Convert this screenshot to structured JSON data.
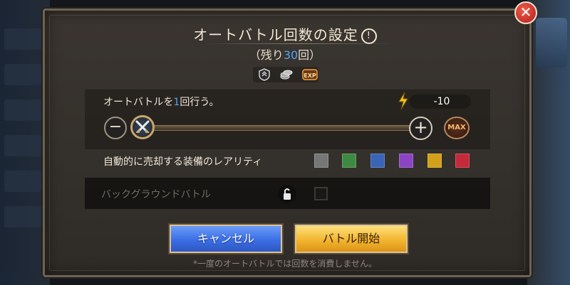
{
  "dialog": {
    "title": "オートバトル回数の設定",
    "info_icon": "!",
    "remaining_prefix": "（残り",
    "remaining_count": "30",
    "remaining_suffix": "回）",
    "close_icon": "✕"
  },
  "reward_icons": [
    "emblem-icon",
    "coins-icon",
    "exp-icon"
  ],
  "exp_icon_text": "EXP",
  "auto_battle": {
    "label_prefix": "オートバトルを",
    "count": "1",
    "label_suffix": "回行う。",
    "energy_value": "-10",
    "slider_value": 1,
    "slider_max": 30,
    "minus": "−",
    "plus": "+",
    "max": "MAX"
  },
  "rarity": {
    "label": "自動的に売却する装備のレアリティ",
    "colors": [
      "#767676",
      "#3f8a43",
      "#3a64b6",
      "#8c45c2",
      "#d3a019",
      "#c42a39"
    ]
  },
  "background_battle": {
    "label": "バックグラウンドバトル"
  },
  "buttons": {
    "cancel": "キャンセル",
    "start": "バトル開始"
  },
  "footnote": "*一度のオートバトルでは回数を消費しません。"
}
